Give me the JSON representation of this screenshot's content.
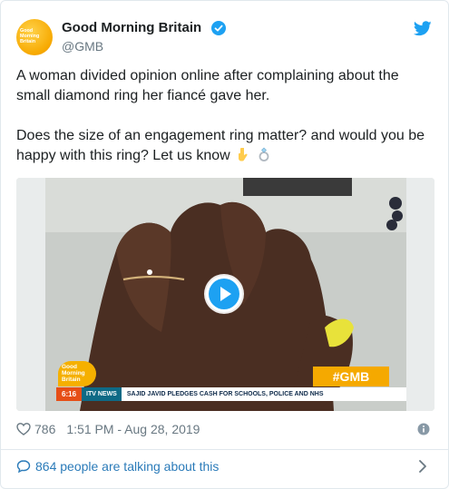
{
  "account": {
    "name": "Good Morning Britain",
    "handle": "@GMB",
    "avatar_text": "Good\nMorning\nBritain",
    "verified": true
  },
  "tweet": {
    "paragraph1": "A woman divided opinion online after complaining about the small diamond ring her fiancé gave her.",
    "paragraph2": "Does the size of an engagement ring matter? and would you be happy with this ring? Let us know",
    "emojis": [
      "point-down-emoji",
      "ring-emoji"
    ]
  },
  "media": {
    "logo_text": "Good\nMorning\nBritain",
    "ticker_time": "6:16",
    "ticker_brand": "ITV NEWS",
    "ticker_headline": "SAJID JAVID PLEDGES CASH FOR SCHOOLS, POLICE AND NHS",
    "hashtag": "#GMB"
  },
  "meta": {
    "likes": "786",
    "timestamp": "1:51 PM - Aug 28, 2019"
  },
  "footer": {
    "talking": "864 people are talking about this"
  },
  "colors": {
    "brand_blue": "#1da1f2",
    "link": "#2b7bb9",
    "gmb_orange": "#f5a900"
  }
}
